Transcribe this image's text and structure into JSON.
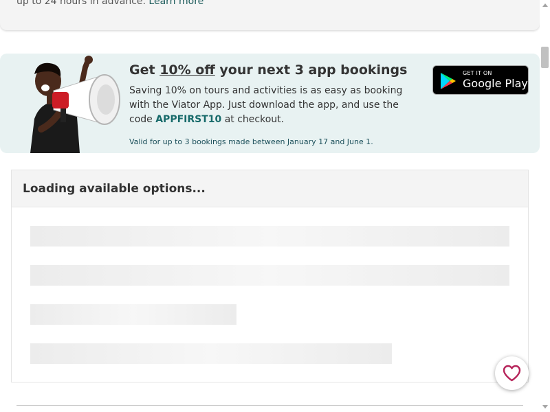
{
  "top_card": {
    "text": "up to 24 hours in advance.",
    "link_label": "Learn more"
  },
  "promo": {
    "heading_prefix": "Get",
    "heading_highlight": "10% off",
    "heading_suffix": "your next 3 app bookings",
    "body_text": "Saving 10% on tours and activities is as easy as booking with the Viator App. Just download the app, and use the code",
    "promo_code": "APPFIRST10",
    "body_suffix": "at checkout.",
    "fine_print": "Valid for up to 3 bookings made between January 17 and June 1.",
    "badge_small": "GET IT ON",
    "badge_large": "Google Play"
  },
  "availability": {
    "loading_title": "Loading available options..."
  },
  "icons": {
    "favorite": "heart-icon",
    "store": "google-play-icon",
    "promo_art": "megaphone-icon"
  },
  "colors": {
    "accent": "#186b6b",
    "promo_background": "#e8f2f2",
    "favorite": "#b6245a"
  }
}
